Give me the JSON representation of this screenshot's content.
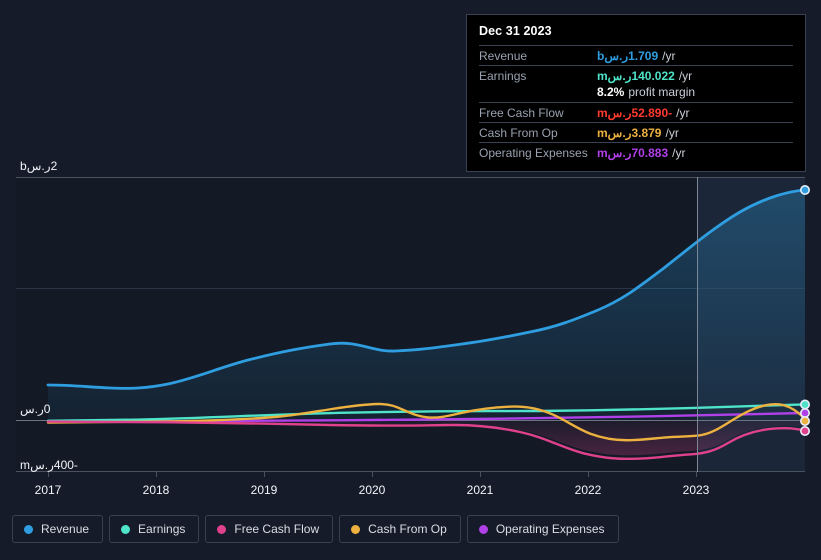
{
  "currency": "ر.س",
  "colors": {
    "revenue": "#2f9ee0",
    "earnings": "#4fe3c9",
    "free_cash_flow": "#e0418c",
    "cash_from_op": "#ecb13f",
    "operating_expenses": "#b040e8",
    "background": "#151b28",
    "plot_background": "#131a26",
    "gridline": "#39404f",
    "tooltip_background": "#000000",
    "negative_value": "#ff3b30",
    "text_muted": "#9aa2b1",
    "text_primary": "#f2f4f8"
  },
  "tooltip": {
    "date": "Dec 31 2023",
    "rows": [
      {
        "label": "Revenue",
        "value": "1.709ر.سb",
        "suffix": "/yr",
        "color": "#2f9ee0"
      },
      {
        "label": "Earnings",
        "value": "140.022ر.سm",
        "suffix": "/yr",
        "color": "#4fe3c9"
      },
      {
        "label": "",
        "value": "8.2%",
        "suffix": "profit margin",
        "color": "#ffffff"
      },
      {
        "label": "Free Cash Flow",
        "value": "-52.890ر.سm",
        "suffix": "/yr",
        "color": "#ff3b30"
      },
      {
        "label": "Cash From Op",
        "value": "3.879ر.سm",
        "suffix": "/yr",
        "color": "#ecb13f"
      },
      {
        "label": "Operating Expenses",
        "value": "70.883ر.سm",
        "suffix": "/yr",
        "color": "#b040e8"
      }
    ]
  },
  "legend": {
    "items": [
      {
        "label": "Revenue",
        "color": "#2f9ee0"
      },
      {
        "label": "Earnings",
        "color": "#4fe3c9"
      },
      {
        "label": "Free Cash Flow",
        "color": "#e0418c"
      },
      {
        "label": "Cash From Op",
        "color": "#ecb13f"
      },
      {
        "label": "Operating Expenses",
        "color": "#b040e8"
      }
    ]
  },
  "axes": {
    "y_top_label": "2ر.سb",
    "y_zero_label": "0ر.س",
    "y_bottom_label": "-400ر.سm",
    "x_labels": [
      "2017",
      "2018",
      "2019",
      "2020",
      "2021",
      "2022",
      "2023"
    ]
  },
  "chart_data": {
    "type": "line",
    "title": "",
    "xlabel": "",
    "ylabel": "",
    "ylim": [
      -400000000,
      2000000000
    ],
    "y_ticks": [
      {
        "value": 2000000000,
        "label": "2ر.سb"
      },
      {
        "value": 0,
        "label": "0ر.س"
      },
      {
        "value": -400000000,
        "label": "-400ر.سm"
      }
    ],
    "x": [
      "2017",
      "2018",
      "2019",
      "2020",
      "2021",
      "2022",
      "2023",
      "2023-12-31"
    ],
    "x_tick_labels": [
      "2017",
      "2018",
      "2019",
      "2020",
      "2021",
      "2022",
      "2023"
    ],
    "grid": true,
    "legend_position": "bottom",
    "cursor": {
      "x_label": "2023",
      "visible": true
    },
    "units": "ر.س",
    "series": [
      {
        "name": "Revenue",
        "color": "#2f9ee0",
        "end_value": "1.709ر.سb",
        "values": [
          0.3,
          0.29,
          0.285,
          0.33,
          0.42,
          0.47,
          0.49,
          0.52,
          0.56,
          0.6,
          0.64,
          0.68,
          0.72,
          0.79,
          0.9,
          1.06,
          1.27,
          1.48,
          1.64,
          1.709
        ]
      },
      {
        "name": "Earnings",
        "color": "#4fe3c9",
        "end_value": "140.022ر.سm",
        "values": [
          0.005,
          0.006,
          0.008,
          0.012,
          0.018,
          0.03,
          0.042,
          0.05,
          0.055,
          0.06,
          0.062,
          0.058,
          0.054,
          0.056,
          0.062,
          0.07,
          0.082,
          0.1,
          0.126,
          0.14
        ]
      },
      {
        "name": "Free Cash Flow",
        "color": "#e0418c",
        "end_value": "-52.890ر.سm",
        "values": [
          0.0,
          -0.002,
          -0.004,
          -0.004,
          -0.003,
          -0.006,
          -0.012,
          -0.014,
          -0.01,
          -0.014,
          -0.022,
          -0.03,
          -0.07,
          -0.125,
          -0.155,
          -0.148,
          -0.15,
          -0.096,
          -0.06,
          -0.053
        ]
      },
      {
        "name": "Cash From Op",
        "color": "#ecb13f",
        "end_value": "3.879ر.سm",
        "values": [
          0.002,
          0.004,
          0.006,
          0.01,
          0.022,
          0.04,
          0.05,
          0.046,
          0.022,
          0.026,
          0.046,
          0.06,
          0.03,
          -0.04,
          -0.082,
          -0.07,
          -0.02,
          0.06,
          0.09,
          0.004
        ]
      },
      {
        "name": "Operating Expenses",
        "color": "#b040e8",
        "end_value": "70.883ر.سm",
        "values": [
          0.004,
          0.005,
          0.006,
          0.008,
          0.012,
          0.016,
          0.02,
          0.023,
          0.026,
          0.028,
          0.03,
          0.032,
          0.034,
          0.036,
          0.038,
          0.042,
          0.048,
          0.056,
          0.066,
          0.071
        ]
      }
    ]
  }
}
